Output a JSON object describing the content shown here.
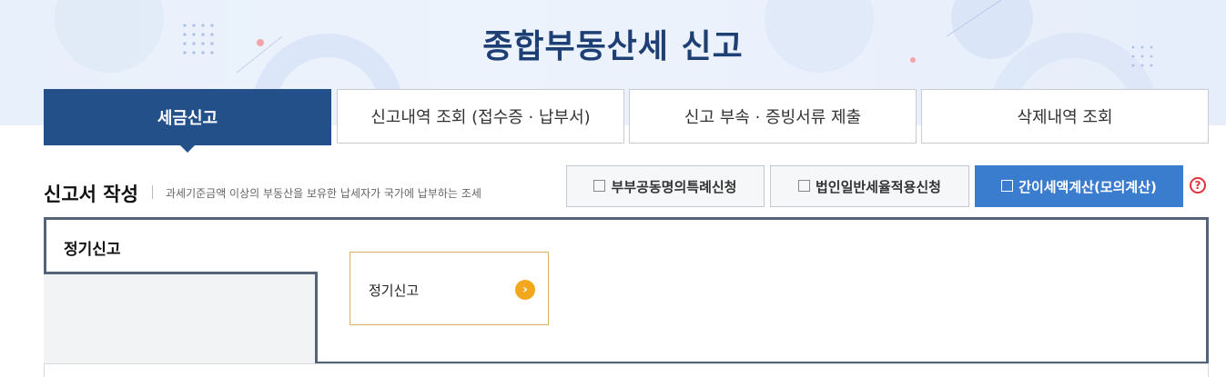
{
  "header": {
    "title": "종합부동산세 신고"
  },
  "tabs": [
    {
      "label": "세금신고",
      "active": true
    },
    {
      "label": "신고내역 조회 (접수증 · 납부서)",
      "active": false
    },
    {
      "label": "신고 부속 · 증빙서류 제출",
      "active": false
    },
    {
      "label": "삭제내역 조회",
      "active": false
    }
  ],
  "section": {
    "title": "신고서 작성",
    "description": "과세기준금액 이상의 부동산을 보유한 납세자가 국가에 납부하는 조세"
  },
  "options": [
    {
      "label": "부부공동명의특례신청",
      "icon": "checkbox-icon",
      "primary": false
    },
    {
      "label": "법인일반세율적용신청",
      "icon": "checkbox-icon",
      "primary": false
    },
    {
      "label": "간이세액계산(모의계산)",
      "icon": "checkbox-icon",
      "primary": true
    }
  ],
  "help": {
    "icon": "question-icon",
    "glyph": "?"
  },
  "sidebar": {
    "items": [
      {
        "label": "정기신고",
        "active": true
      }
    ]
  },
  "cards": [
    {
      "label": "정기신고",
      "arrow": "›",
      "icon": "arrow-right-icon"
    }
  ],
  "colors": {
    "primary": "#24508a",
    "accent": "#3a7ccd",
    "frame": "#546378",
    "card_border": "#d9b35a",
    "card_arrow": "#f2a71c",
    "help": "#e0323c"
  }
}
